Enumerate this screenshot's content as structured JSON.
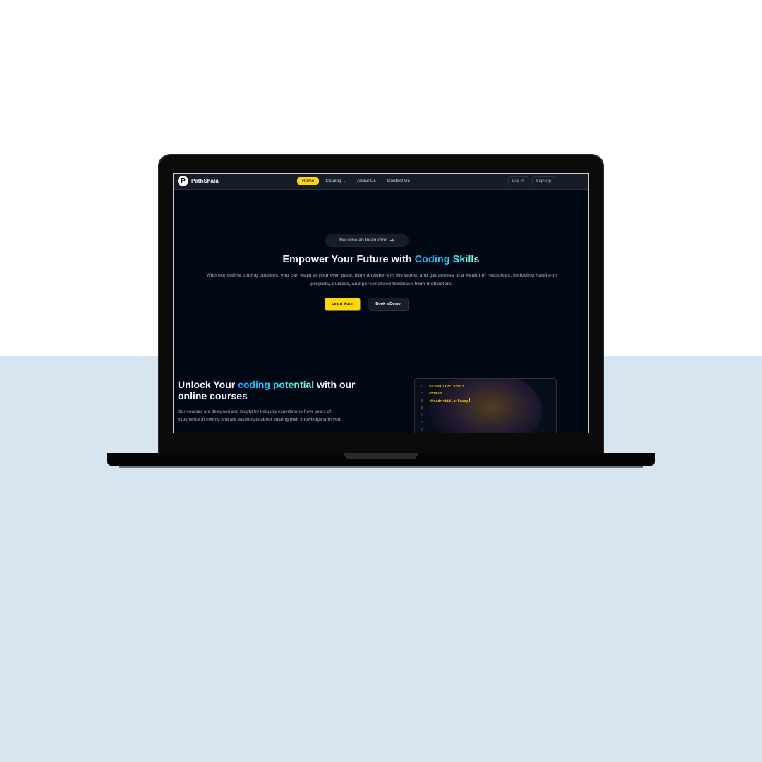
{
  "brand": {
    "logo_letter": "P",
    "name": "PathShala"
  },
  "nav": {
    "links": [
      {
        "label": "Home",
        "active": true
      },
      {
        "label": "Catalog",
        "dropdown": true
      },
      {
        "label": "About Us"
      },
      {
        "label": "Contact Us"
      }
    ],
    "login_label": "Log In",
    "signup_label": "Sign Up"
  },
  "hero": {
    "pill_label": "Become an Instructor",
    "title_prefix": "Empower Your Future with",
    "title_highlight": "Coding Skills",
    "subtitle": "With our online coding courses, you can learn at your own pace, from anywhere in the world, and get access to a wealth of resources, including hands-on projects, quizzes, and personalized feedback from instructors.",
    "primary_cta": "Learn More",
    "secondary_cta": "Book a Demo"
  },
  "section": {
    "title_prefix": "Unlock Your",
    "title_highlight": "coding potential",
    "title_suffix": "with our online courses",
    "description": "Our courses are designed and taught by industry experts who have years of experience in coding and are passionate about sharing their knowledge with you."
  },
  "code_block": {
    "lines": [
      {
        "n": "1",
        "text": "<<!DOCTYPE html>"
      },
      {
        "n": "2",
        "text": "<html>"
      },
      {
        "n": "3",
        "text": "<head><title>Examp"
      },
      {
        "n": "4",
        "text": ""
      },
      {
        "n": "5",
        "text": ""
      },
      {
        "n": "6",
        "text": ""
      },
      {
        "n": "7",
        "text": ""
      }
    ]
  },
  "colors": {
    "accent_yellow": "#ffd60a",
    "screen_bg": "#000814",
    "nav_bg": "#161d29",
    "highlight_blue": "#12d8fa",
    "desk": "#d7e5f0"
  },
  "icons": {
    "pill_arrow": "arrow-right-icon",
    "dropdown": "chevron-down-icon"
  }
}
